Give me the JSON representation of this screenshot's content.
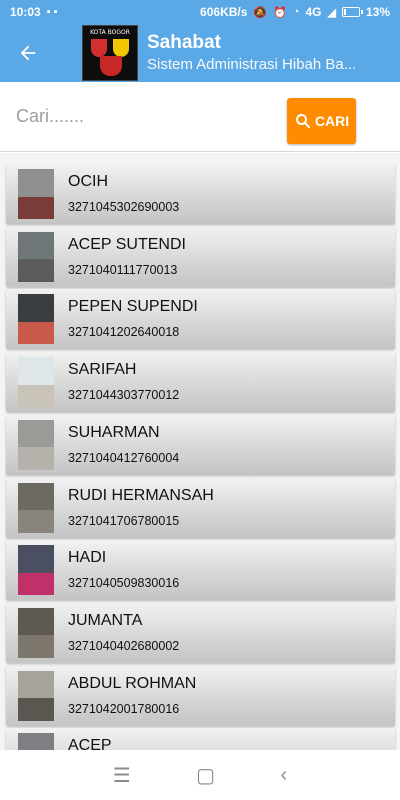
{
  "status_bar": {
    "time": "10:03",
    "speed": "606KB/s",
    "network": "4G",
    "battery": "13%",
    "battery_level": 0.13
  },
  "app_bar": {
    "back_icon": "arrow-left-icon",
    "logo_text": "KOTA BOGOR",
    "title": "Sahabat",
    "subtitle": "Sistem Administrasi Hibah Ba..."
  },
  "search": {
    "placeholder": "Cari.......",
    "value": "",
    "button_label": "CARI",
    "button_icon": "search-icon"
  },
  "list": {
    "items": [
      {
        "name": "OCIH",
        "nik": "3271045302690003"
      },
      {
        "name": "ACEP SUTENDI",
        "nik": "3271040111770013"
      },
      {
        "name": "PEPEN SUPENDI",
        "nik": "3271041202640018"
      },
      {
        "name": "SARIFAH",
        "nik": "3271044303770012"
      },
      {
        "name": "SUHARMAN",
        "nik": "3271040412760004"
      },
      {
        "name": "RUDI HERMANSAH",
        "nik": "3271041706780015"
      },
      {
        "name": "HADI",
        "nik": "3271040509830016"
      },
      {
        "name": "JUMANTA",
        "nik": "3271040402680002"
      },
      {
        "name": "ABDUL ROHMAN",
        "nik": "3271042001780016"
      },
      {
        "name": "ACEP",
        "nik": ""
      }
    ]
  },
  "nav_bar": {
    "icons": [
      "menu-icon",
      "home-square-icon",
      "back-chevron-icon"
    ]
  },
  "colors": {
    "app_bar": "#5aa8e6",
    "button": "#ff8c00"
  }
}
